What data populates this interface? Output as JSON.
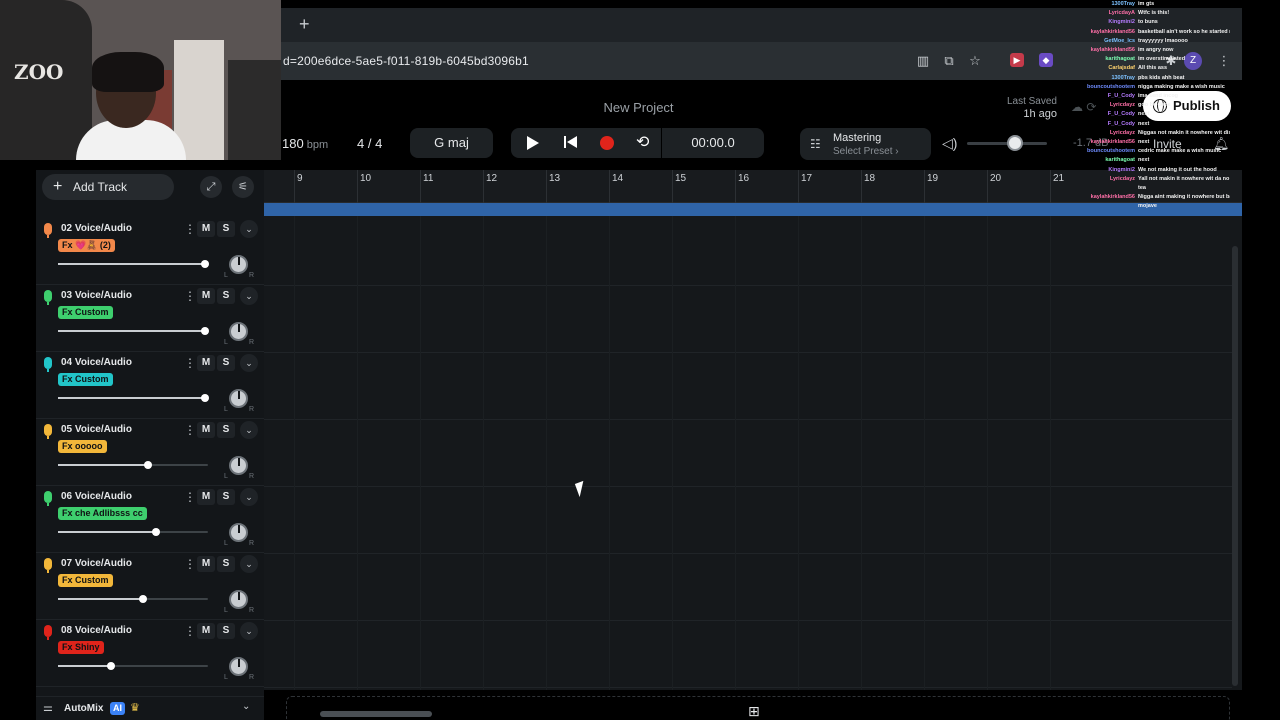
{
  "browser": {
    "new_tab_label": "+",
    "url": "d=200e6dce-5ae5-f011-819b-6045bd3096b1",
    "profile_initial": "Z"
  },
  "header": {
    "project_title": "New Project",
    "last_saved_label": "Last Saved",
    "last_saved_value": "1h ago",
    "publish_label": "Publish",
    "invite_label": "Invite"
  },
  "transport": {
    "bpm_value": "180",
    "bpm_unit": "bpm",
    "time_signature": "4 / 4",
    "key": "G maj",
    "timecode": "00:00.0",
    "mastering_title": "Mastering",
    "mastering_preset": "Select Preset ›",
    "db_readout": "-1.7 dB",
    "master_volume_level": 0.6
  },
  "left_panel": {
    "add_track_label": "Add Track",
    "automix_label": "AutoMix",
    "automix_badge": "AI"
  },
  "tracks": [
    {
      "name": "02  Voice/Audio",
      "fx": "Fx 💗🧸 (2)",
      "fx_color": "#f2884a",
      "mic_color": "#f2884a",
      "volume": 0.98
    },
    {
      "name": "03  Voice/Audio",
      "fx": "Fx Custom",
      "fx_color": "#3ecf6e",
      "mic_color": "#3ecf6e",
      "volume": 0.98
    },
    {
      "name": "04  Voice/Audio",
      "fx": "Fx Custom",
      "fx_color": "#22c5c9",
      "mic_color": "#22c5c9",
      "volume": 0.98
    },
    {
      "name": "05  Voice/Audio",
      "fx": "Fx ooooo",
      "fx_color": "#f2b73a",
      "mic_color": "#f2b73a",
      "volume": 0.6
    },
    {
      "name": "06  Voice/Audio",
      "fx": "Fx che Adlibsss cc",
      "fx_color": "#3ecf6e",
      "mic_color": "#3ecf6e",
      "volume": 0.65
    },
    {
      "name": "07  Voice/Audio",
      "fx": "Fx Custom",
      "fx_color": "#f2b73a",
      "mic_color": "#f2b73a",
      "volume": 0.57
    },
    {
      "name": "08  Voice/Audio",
      "fx": "Fx Shiny",
      "fx_color": "#e0241b",
      "mic_color": "#e0241b",
      "volume": 0.35
    }
  ],
  "ruler": {
    "bars": [
      "9",
      "10",
      "11",
      "12",
      "13",
      "14",
      "15",
      "16",
      "17",
      "18",
      "19",
      "20",
      "21"
    ]
  },
  "webcam": {
    "shirt_text": "ZOO"
  },
  "chat": [
    {
      "user": "1300Tray",
      "msg": "im gts",
      "color": "#7cc1ff"
    },
    {
      "user": "LyricdayA",
      "msg": "Wtfc is this!",
      "color": "#ff6fa8"
    },
    {
      "user": "Kingmini2",
      "msg": "to buns",
      "color": "#b57bff"
    },
    {
      "user": "kaylahkirkland56",
      "msg": "basketball ain't work so he started rapping",
      "color": "#ff6fa8"
    },
    {
      "user": "GetMoe_lcs",
      "msg": "trayyyyyy lmaoooo",
      "color": "#7cc1ff"
    },
    {
      "user": "kaylahkirkland56",
      "msg": "im angry now",
      "color": "#ff6fa8"
    },
    {
      "user": "karithagoat",
      "msg": "im overstimulated",
      "color": "#7cffb2"
    },
    {
      "user": "Carlajsdaf",
      "msg": "All this ass",
      "color": "#ffd36f"
    },
    {
      "user": "1300Tray",
      "msg": "pbs kids ahh beat",
      "color": "#7cc1ff"
    },
    {
      "user": "bouncoutshootem",
      "msg": "nigga making make a wish music",
      "color": "#6f8cff"
    },
    {
      "user": "F_U_Cody",
      "msg": "ima send incog",
      "color": "#b57bff"
    },
    {
      "user": "Lyricdayz",
      "msg": "goo be done",
      "color": "#ff6fa8"
    },
    {
      "user": "F_U_Cody",
      "msg": "next",
      "color": "#b57bff"
    },
    {
      "user": "F_U_Cody",
      "msg": "next",
      "color": "#b57bff"
    },
    {
      "user": "Lyricdayz",
      "msg": "Niggas not makin it nowhere wit dis!!",
      "color": "#ff6fa8"
    },
    {
      "user": "kaylahkirkland56",
      "msg": "next",
      "color": "#ff6fa8"
    },
    {
      "user": "bouncoutshootem",
      "msg": "cedric make make a wish music",
      "color": "#6f8cff"
    },
    {
      "user": "karithagoat",
      "msg": "next",
      "color": "#7cffb2"
    },
    {
      "user": "Kingmini2",
      "msg": "We not making it out the hood",
      "color": "#b57bff"
    },
    {
      "user": "Lyricdayz",
      "msg": "Yall not makin it nowhere wit da no shade",
      "color": "#ff6fa8"
    },
    {
      "user": "",
      "msg": "tea",
      "color": "#ff6fa8"
    },
    {
      "user": "kaylahkirkland56",
      "msg": "Nigga aint making it nowhere but back to",
      "color": "#ff6fa8"
    },
    {
      "user": "",
      "msg": "mojave",
      "color": "#ff6fa8"
    }
  ]
}
